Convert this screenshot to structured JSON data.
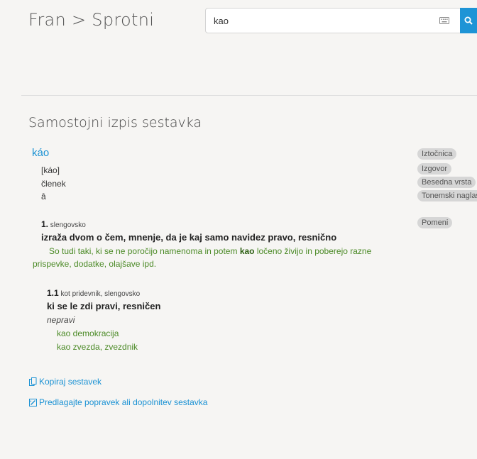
{
  "header": {
    "brand": "Fran > Sprotni",
    "search_value": "kao"
  },
  "page_title": "Samostojni izpis sestavka",
  "entry": {
    "headword": "káo",
    "pronunciation": "[káo]",
    "word_class": "členek",
    "tonal_accent": "â",
    "sense1": {
      "number": "1.",
      "qualifier": " slengovsko",
      "definition": "izraža dvom o čem, mnenje, da je kaj samo navidez pravo, resnično",
      "example_before": "So tudi taki, ki se ne poročijo namenoma in potem ",
      "example_keyword": "kao",
      "example_after": " ločeno živijo in poberejo razne",
      "example_line2": "prispevke, dodatke, olajšave ipd."
    },
    "sense11": {
      "number": "1.1",
      "qualifier": " kot pridevnik, slengovsko",
      "definition": "ki se le zdi pravi, resničen",
      "synonym": "nepravi",
      "example1": "kao demokracija",
      "example2": "kao zvezda, zvezdnik"
    }
  },
  "labels": {
    "source": "Iztočnica",
    "pronunciation": "Izgovor",
    "word_class": "Besedna vrsta",
    "tonal_accent": "Tonemski naglas",
    "meanings": "Pomeni"
  },
  "actions": {
    "copy": "Kopiraj sestavek",
    "suggest": "Predlagajte popravek ali dopolnitev sestavka"
  },
  "colors": {
    "accent": "#1e94d6",
    "example_green": "#4b8a26"
  },
  "icons": [
    "keyboard-icon",
    "search-icon",
    "copy-icon",
    "edit-icon"
  ]
}
